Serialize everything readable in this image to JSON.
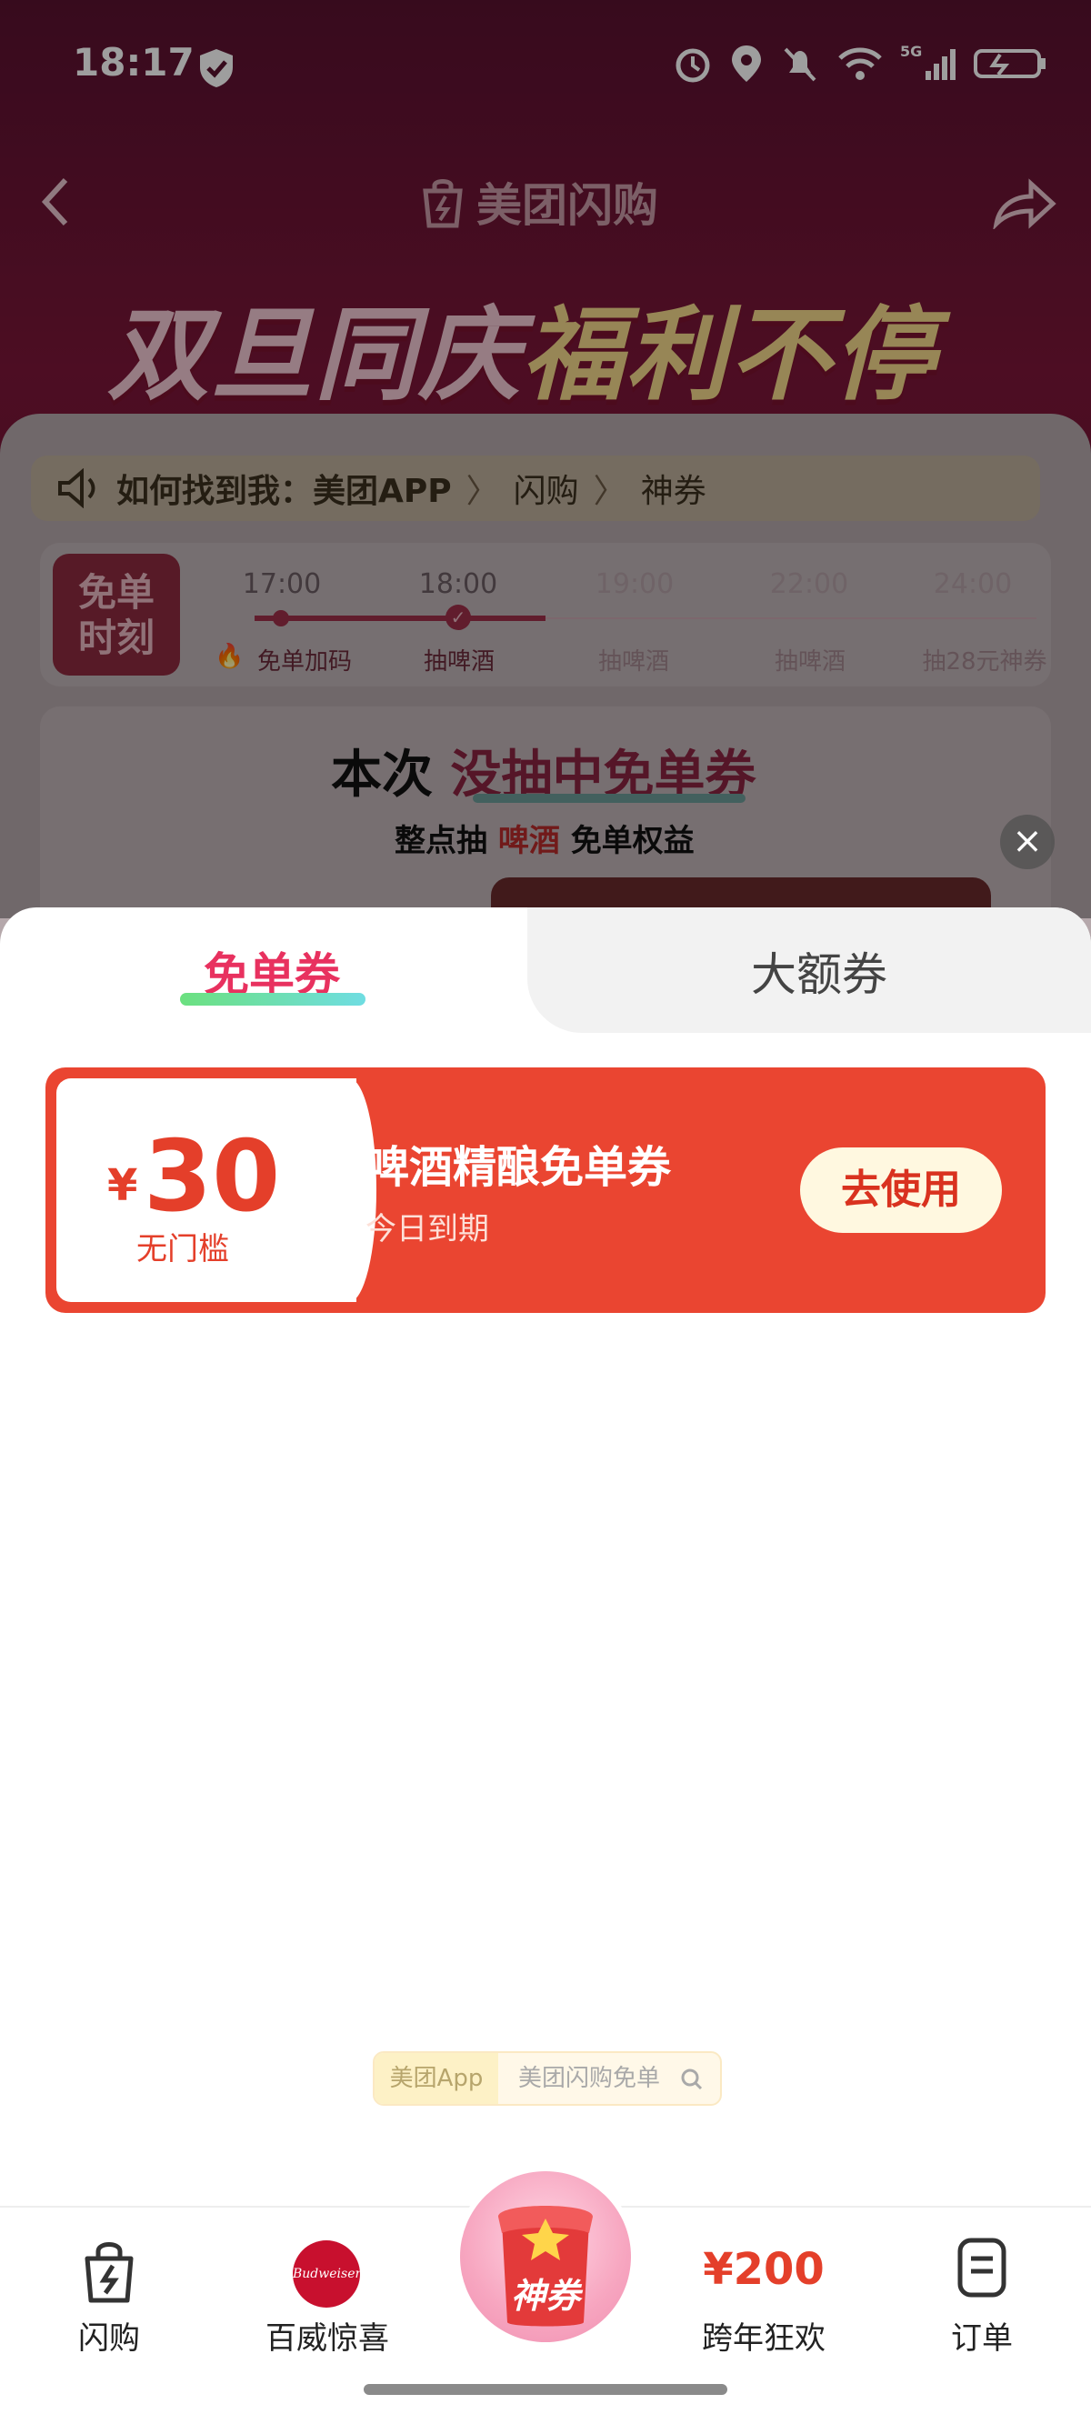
{
  "status_bar": {
    "time": "18:17"
  },
  "header": {
    "title": "美团闪购"
  },
  "banner": {
    "left": "双旦同庆",
    "right": "福利不停"
  },
  "info_bar": {
    "text": "如何找到我：美团APP",
    "crumb_1": "闪购",
    "crumb_2": "神券"
  },
  "timeline": {
    "badge": "免单时刻",
    "slots": [
      {
        "time": "17:00",
        "label": "免单加码"
      },
      {
        "time": "18:00",
        "label": "抽啤酒"
      },
      {
        "time": "19:00",
        "label": "抽啤酒"
      },
      {
        "time": "22:00",
        "label": "抽啤酒"
      },
      {
        "time": "24:00",
        "label": "抽28元神券"
      }
    ]
  },
  "result": {
    "prefix": "本次",
    "highlight": "没抽中免单券",
    "sub_a": "整点抽",
    "sub_hl": "啤酒",
    "sub_b": "免单权益"
  },
  "sheet": {
    "tabs": [
      {
        "label": "免单券"
      },
      {
        "label": "大额券"
      }
    ],
    "coupon": {
      "currency": "¥",
      "amount": "30",
      "condition": "无门槛",
      "title": "啤酒精酿免单券",
      "expiry": "今日到期",
      "button": "去使用"
    },
    "search_pill": {
      "left": "美团App",
      "right": "美团闪购免单"
    }
  },
  "nav": {
    "items": [
      {
        "label": "闪购",
        "icon": "bag-bolt-icon"
      },
      {
        "label": "百威惊喜",
        "icon": "budweiser-logo"
      },
      {
        "label": "神券",
        "icon": "coupon-bag-icon"
      },
      {
        "label": "跨年狂欢",
        "price": "¥200"
      },
      {
        "label": "订单",
        "icon": "order-list-icon"
      }
    ]
  },
  "colors": {
    "accent": "#ea4531",
    "tab_active": "#e8315f",
    "button_bg": "#fff8e0"
  }
}
